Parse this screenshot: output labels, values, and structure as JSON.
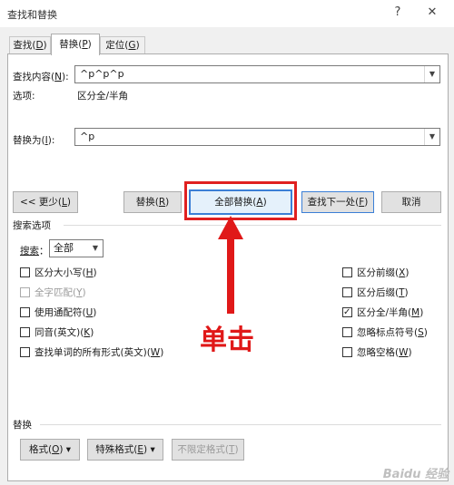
{
  "window": {
    "title": "查找和替换",
    "help_button": "?",
    "close_button": "✕"
  },
  "tabs": [
    {
      "label": "查找(",
      "key": "D",
      "end": ")"
    },
    {
      "label": "替换(",
      "key": "P",
      "end": ")"
    },
    {
      "label": "定位(",
      "key": "G",
      "end": ")"
    }
  ],
  "find": {
    "label": "查找内容(",
    "key": "N",
    "label_end": "):",
    "value": "^p^p^p",
    "options_label": "选项:",
    "options_value": "区分全/半角"
  },
  "replace": {
    "label": "替换为(",
    "key": "I",
    "label_end": "):",
    "value": "^p"
  },
  "buttons": {
    "less": {
      "label": "<< 更少(",
      "key": "L",
      "end": ")"
    },
    "replace": {
      "label": "替换(",
      "key": "R",
      "end": ")"
    },
    "replace_all": {
      "label": "全部替换(",
      "key": "A",
      "end": ")"
    },
    "find_next": {
      "label": "查找下一处(",
      "key": "F",
      "end": ")"
    },
    "cancel": {
      "label": "取消"
    }
  },
  "search_options": {
    "heading": "搜索选项",
    "search_label": "搜索",
    "search_key": "：",
    "search_value": "全部",
    "left_options": [
      {
        "label": "区分大小写(",
        "key": "H",
        "end": ")",
        "checked": false,
        "disabled": false
      },
      {
        "label": "全字匹配(",
        "key": "Y",
        "end": ")",
        "checked": false,
        "disabled": true
      },
      {
        "label": "使用通配符(",
        "key": "U",
        "end": ")",
        "checked": false,
        "disabled": false
      },
      {
        "label": "同音(英文)(",
        "key": "K",
        "end": ")",
        "checked": false,
        "disabled": false
      },
      {
        "label": "查找单词的所有形式(英文)(",
        "key": "W",
        "end": ")",
        "checked": false,
        "disabled": false
      }
    ],
    "right_options": [
      {
        "label": "区分前缀(",
        "key": "X",
        "end": ")",
        "checked": false
      },
      {
        "label": "区分后缀(",
        "key": "T",
        "end": ")",
        "checked": false
      },
      {
        "label": "区分全/半角(",
        "key": "M",
        "end": ")",
        "checked": true
      },
      {
        "label": "忽略标点符号(",
        "key": "S",
        "end": ")",
        "checked": false
      },
      {
        "label": "忽略空格(",
        "key": "W",
        "end": ")",
        "checked": false
      }
    ]
  },
  "replace_section": {
    "heading": "替换",
    "format": {
      "label": "格式(",
      "key": "O",
      "end": ") ▾"
    },
    "special": {
      "label": "特殊格式(",
      "key": "E",
      "end": ") ▾"
    },
    "no_format": {
      "label": "不限定格式(",
      "key": "T",
      "end": ")"
    }
  },
  "annotation": {
    "text": "单击",
    "accent": "#e01818"
  },
  "watermark": "Baidu 经验"
}
